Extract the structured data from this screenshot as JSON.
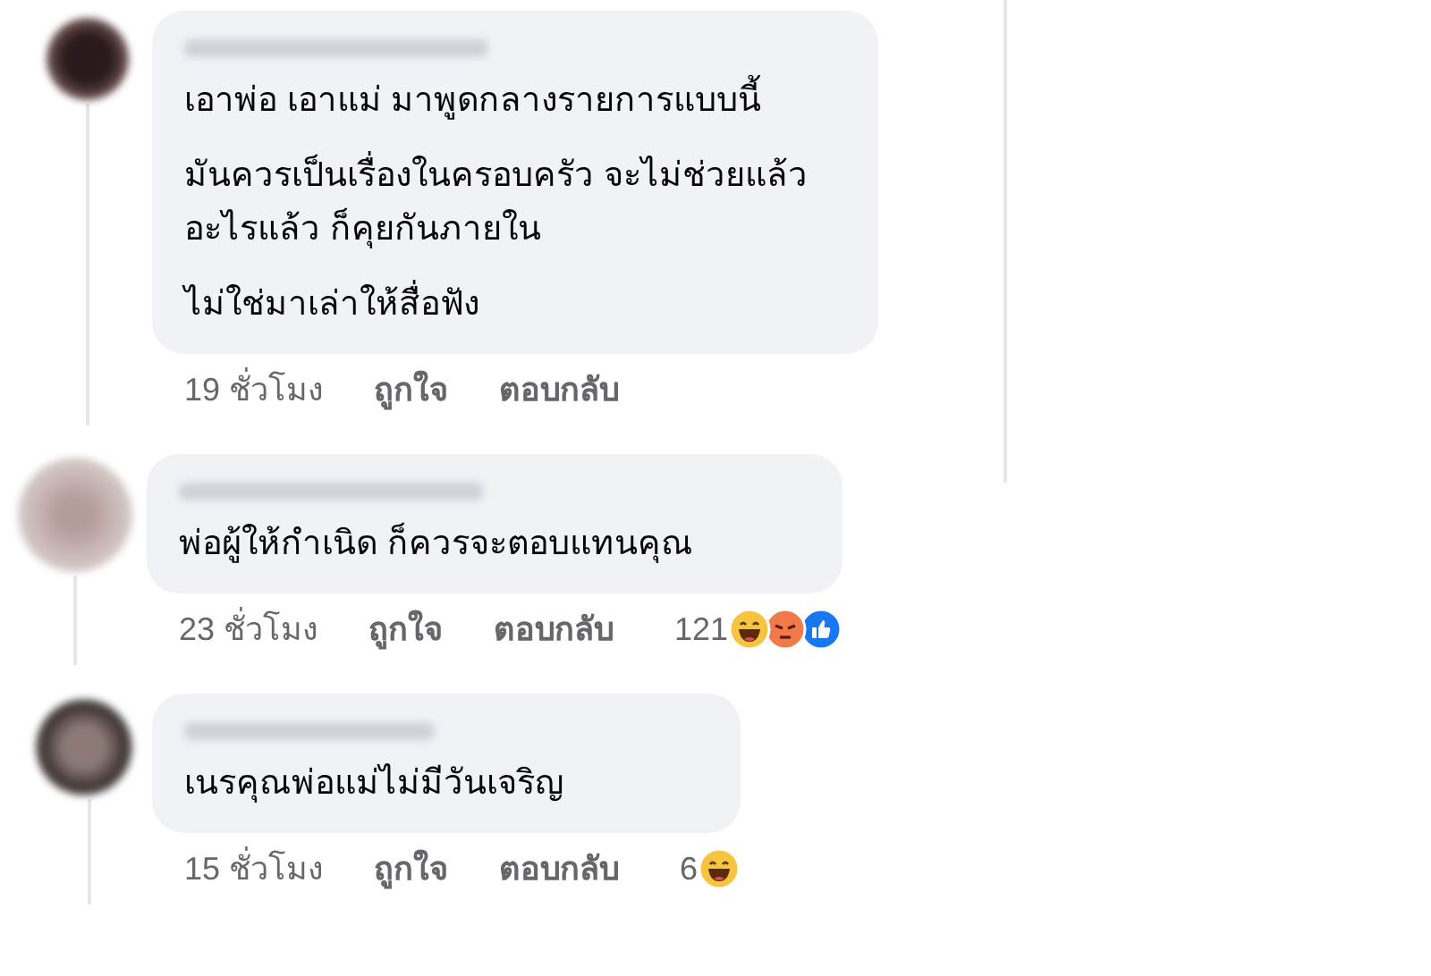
{
  "comments": [
    {
      "paragraphs": [
        "เอาพ่อ เอาแม่ มาพูดกลางรายการแบบนี้",
        "มันควรเป็นเรื่องในครอบครัว จะไม่ช่วยแล้วอะไรแล้ว ก็คุยกันภายใน",
        "ไม่ใช่มาเล่าให้สื่อฟัง"
      ],
      "time": "19 ชั่วโมง",
      "like": "ถูกใจ",
      "reply": "ตอบกลับ"
    },
    {
      "paragraphs": [
        "พ่อผู้ให้กำเนิด ก็ควรจะตอบแทนคุณ"
      ],
      "time": "23 ชั่วโมง",
      "like": "ถูกใจ",
      "reply": "ตอบกลับ",
      "reaction_count": "121",
      "reactions": [
        {
          "kind": "haha"
        },
        {
          "kind": "angry"
        },
        {
          "kind": "like"
        }
      ]
    },
    {
      "paragraphs": [
        "เนรคุณพ่อแม่ไม่มีวันเจริญ"
      ],
      "time": "15 ชั่วโมง",
      "like": "ถูกใจ",
      "reply": "ตอบกลับ",
      "reaction_count": "6",
      "reactions": [
        {
          "kind": "haha"
        }
      ]
    }
  ]
}
